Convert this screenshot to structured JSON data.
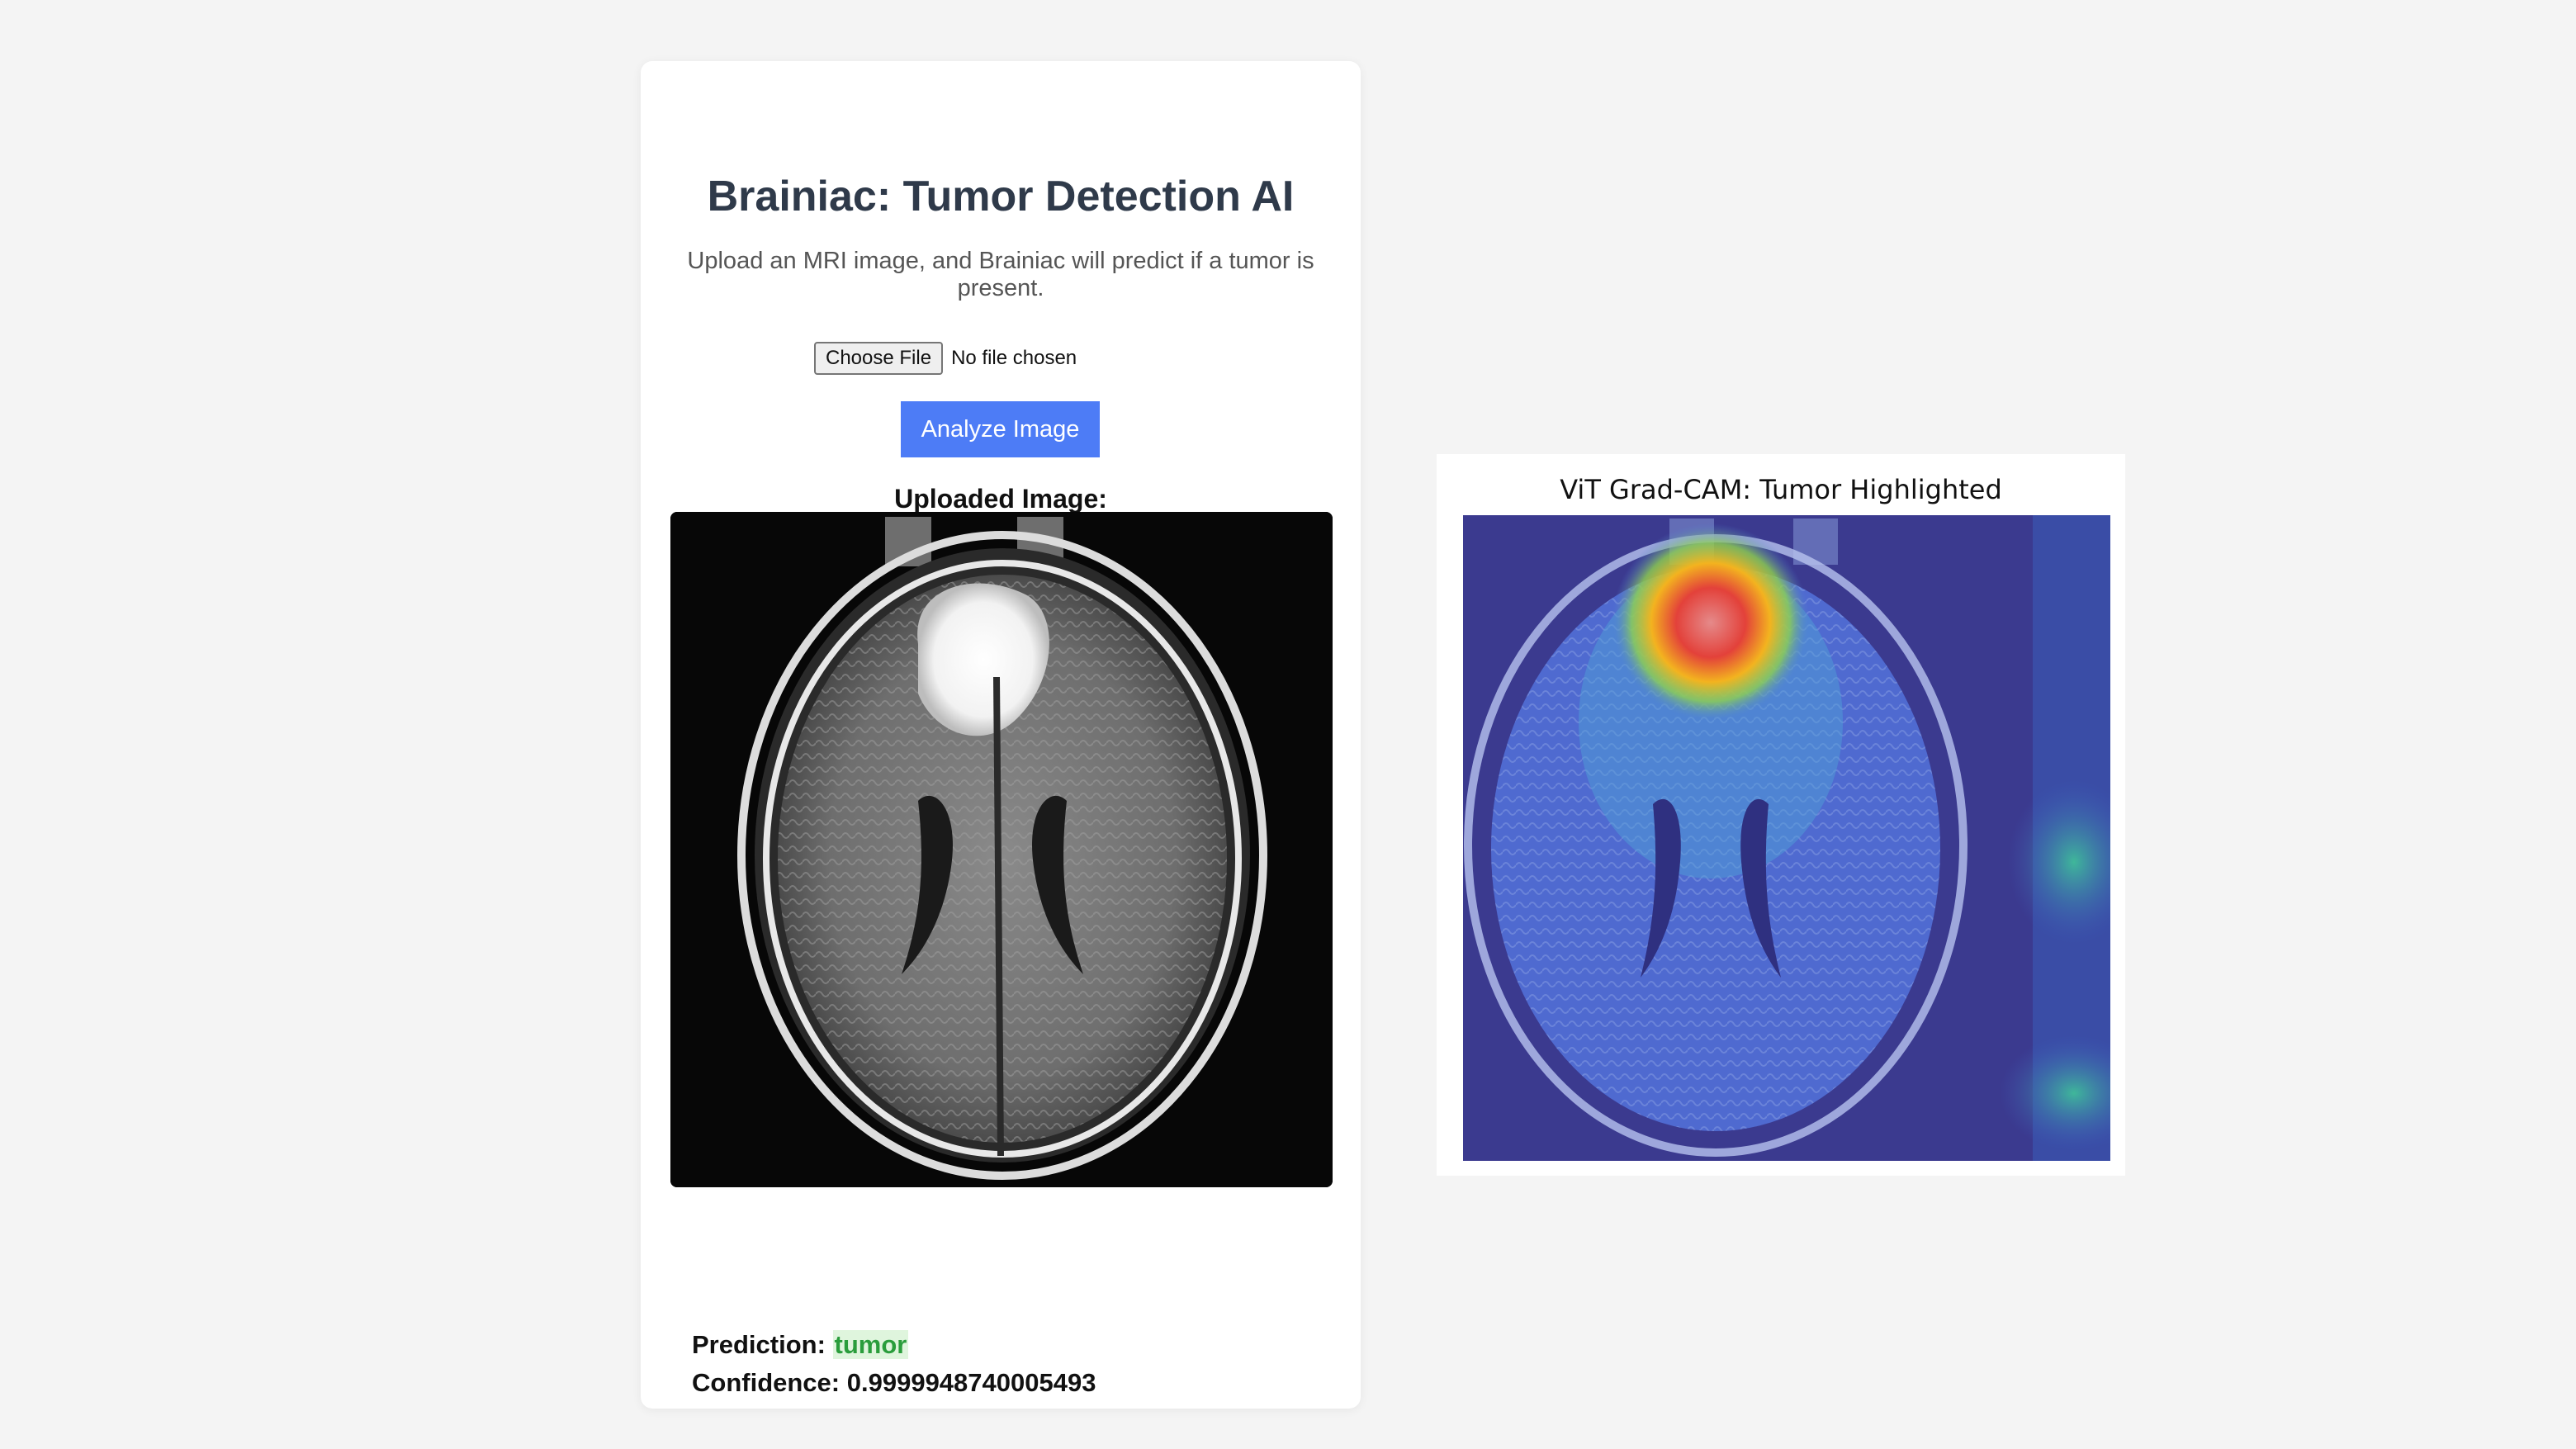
{
  "card": {
    "title": "Brainiac: Tumor Detection AI",
    "subtitle": "Upload an MRI image, and Brainiac will predict if a tumor is present.",
    "file_input": {
      "button_label": "Choose File",
      "status": "No file chosen"
    },
    "analyze_button_label": "Analyze Image",
    "uploaded_label": "Uploaded Image:",
    "prediction": {
      "label": "Prediction:",
      "value": "tumor"
    },
    "confidence": {
      "label": "Confidence:",
      "value": "0.9999948740005493"
    }
  },
  "gradcam": {
    "title": "ViT Grad-CAM: Tumor Highlighted"
  },
  "colors": {
    "accent": "#4d7cf6",
    "page_background": "#f4f4f4",
    "title_color": "#2f3a4a",
    "prediction_color": "#2a9d3c"
  }
}
